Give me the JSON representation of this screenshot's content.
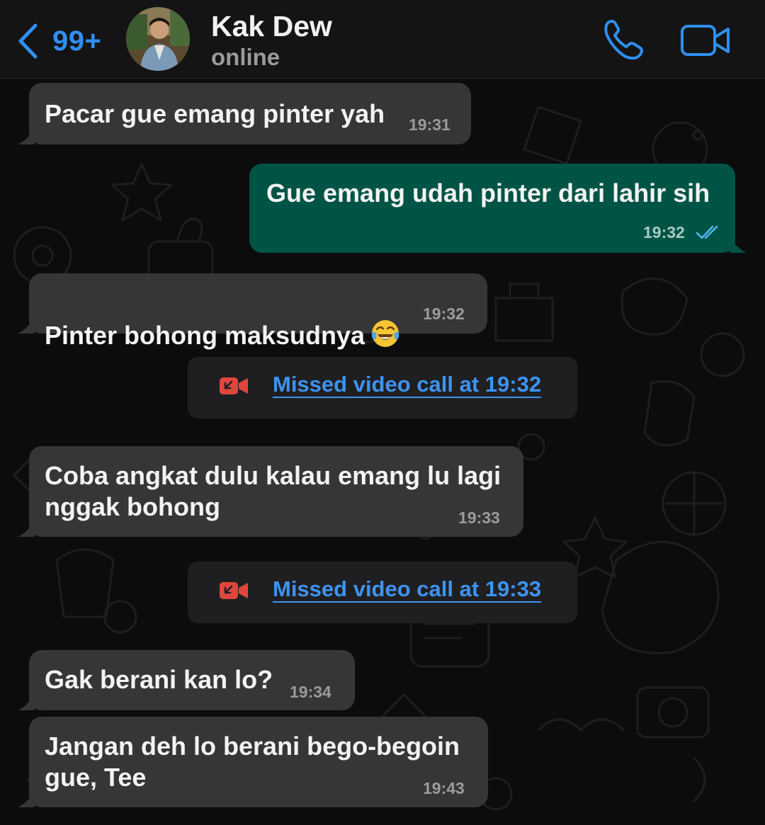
{
  "header": {
    "unread_count": "99+",
    "contact_name": "Kak Dew",
    "contact_status": "online",
    "accent_color": "#2f8ff0"
  },
  "messages": [
    {
      "direction": "in",
      "text": "Pacar gue emang pinter yah",
      "time": "19:31"
    },
    {
      "direction": "out",
      "text": "Gue emang udah pinter dari lahir sih",
      "time": "19:32",
      "status": "read"
    },
    {
      "direction": "in",
      "text": "Pinter bohong maksudnya",
      "emoji": "face-with-tears-of-joy",
      "time": "19:32"
    },
    {
      "type": "system",
      "text": "Missed video call at 19:32",
      "icon": "missed-video-call-icon"
    },
    {
      "direction": "in",
      "text": "Coba angkat dulu kalau emang lu lagi\nnggak bohong",
      "time": "19:33"
    },
    {
      "type": "system",
      "text": "Missed video call at 19:33",
      "icon": "missed-video-call-icon"
    },
    {
      "direction": "in",
      "text": "Gak berani kan lo?",
      "time": "19:34"
    },
    {
      "direction": "in",
      "text": "Jangan deh lo berani bego-begoin\ngue, Tee",
      "time": "19:43"
    }
  ],
  "colors": {
    "incoming_bubble": "#363638",
    "outgoing_bubble": "#005446",
    "link": "#3d93f0",
    "missed_call": "#e0463c"
  }
}
